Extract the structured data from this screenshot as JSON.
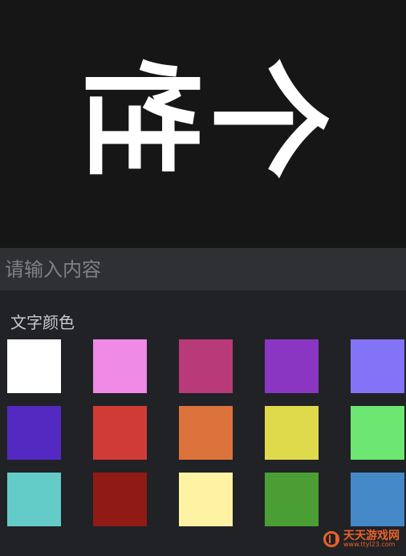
{
  "preview": {
    "text": "个性"
  },
  "input": {
    "placeholder": "请输入内容"
  },
  "color_section": {
    "title": "文字颜色",
    "swatches": [
      [
        "#ffffff",
        "#ef8ae6",
        "#b83a78",
        "#8b35c3",
        "#8374f7"
      ],
      [
        "#5429c2",
        "#d03c35",
        "#dc733c",
        "#dfd94c",
        "#6ee672"
      ],
      [
        "#63cbc8",
        "#901a14",
        "#fef2a3",
        "#4b9e34",
        "#4588c8"
      ]
    ]
  },
  "watermark": {
    "title": "天天游戏网",
    "url": "www.ttyl23.com"
  }
}
